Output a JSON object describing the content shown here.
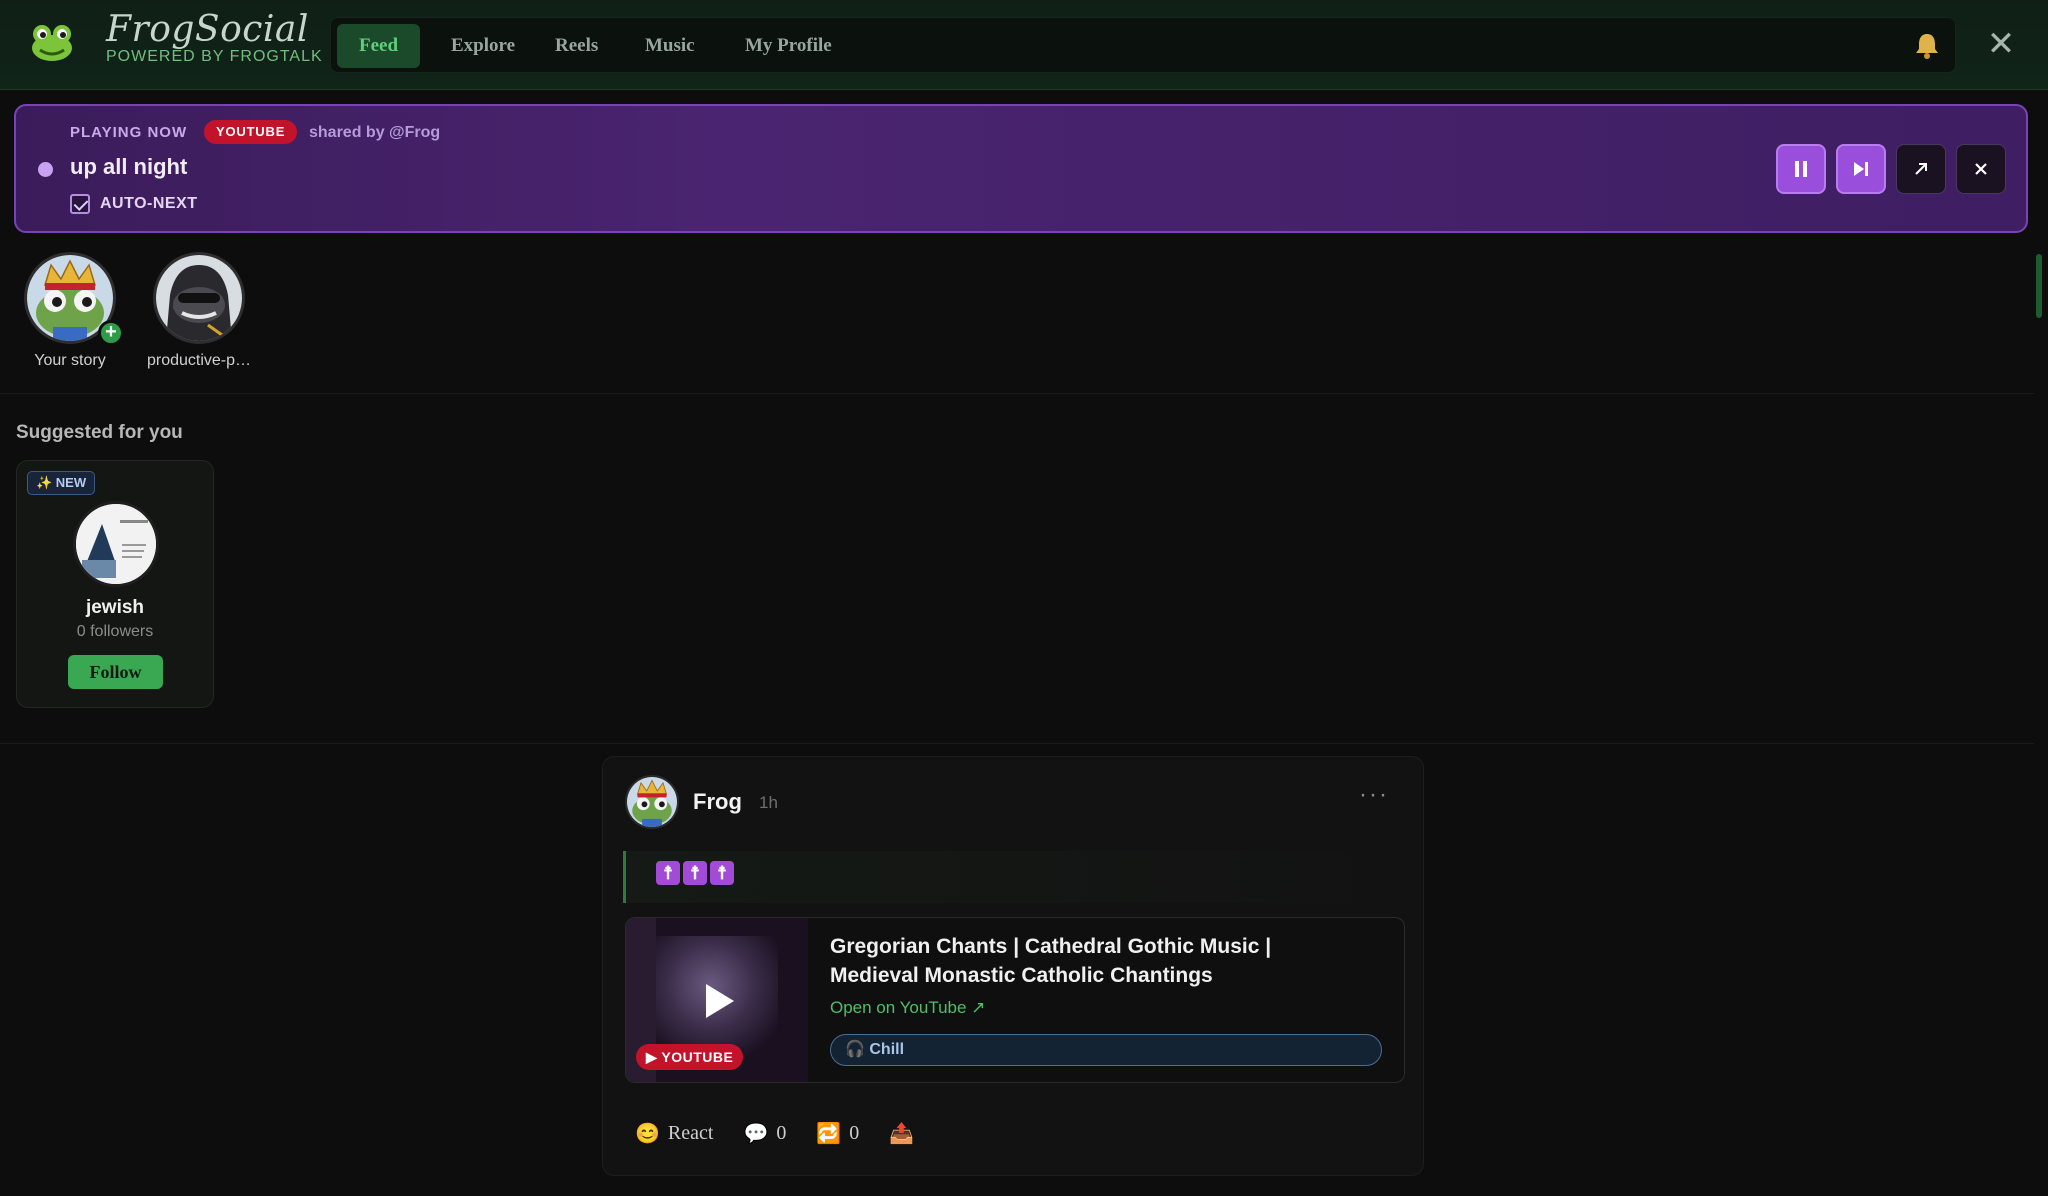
{
  "header": {
    "brand_name": "FrogSocial",
    "brand_sub": "POWERED BY FROGTALK",
    "nav": [
      {
        "label": "Feed",
        "active": true
      },
      {
        "label": "Explore",
        "active": false
      },
      {
        "label": "Reels",
        "active": false
      },
      {
        "label": "Music",
        "active": false
      },
      {
        "label": "My Profile",
        "active": false
      }
    ],
    "close_label": "✕"
  },
  "player": {
    "status": "PLAYING NOW",
    "source": "YOUTUBE",
    "shared_by": "shared by @Frog",
    "title": "up all night",
    "autonext_label": "AUTO-NEXT",
    "autonext_checked": true
  },
  "stories": [
    {
      "label": "Your story"
    },
    {
      "label": "productive-p…"
    }
  ],
  "suggested": {
    "title": "Suggested for you",
    "card": {
      "badge": "✨ NEW",
      "name": "jewish",
      "followers": "0 followers",
      "follow_label": "Follow"
    }
  },
  "post": {
    "author": "Frog",
    "time": "1h",
    "more": "···",
    "content_glyphs": [
      "☨",
      "☨",
      "☨"
    ],
    "embed": {
      "title": "Gregorian Chants | Cathedral Gothic Music | Medieval Monastic Catholic Chantings",
      "link": "Open on YouTube ↗",
      "source_badge": "▶ YOUTUBE",
      "mood": "🎧 Chill"
    },
    "actions": {
      "react": "React",
      "comments": "0",
      "reposts": "0"
    }
  },
  "colors": {
    "accent": "#3aa852",
    "player_bg": "#4a2470",
    "youtube_red": "#c3132a"
  }
}
